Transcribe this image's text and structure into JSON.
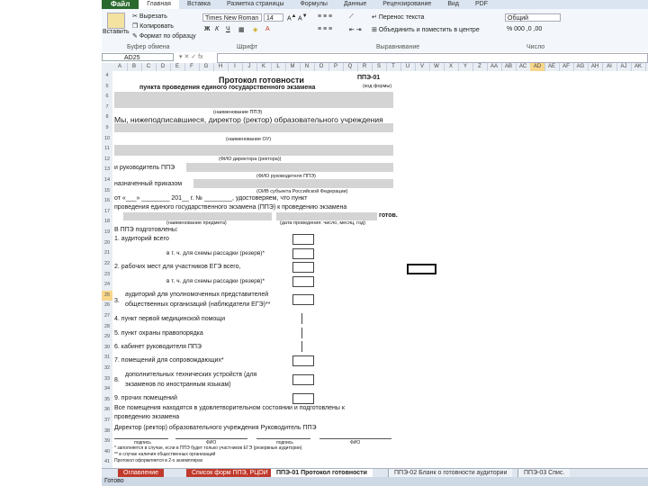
{
  "ribbon_tabs": [
    "Файл",
    "Главная",
    "Вставка",
    "Разметка страницы",
    "Формулы",
    "Данные",
    "Рецензирование",
    "Вид",
    "PDF"
  ],
  "ribbon": {
    "paste_label": "Вставить",
    "cut_label": "Вырезать",
    "copy_label": "Копировать",
    "format_painter_label": "Формат по образцу",
    "clipboard_group": "Буфер обмена",
    "font_name": "Times New Roman",
    "font_size": "14",
    "font_group": "Шрифт",
    "wrap_text_label": "Перенос текста",
    "merge_label": "Объединить и поместить в центре",
    "align_group": "Выравнивание",
    "number_format": "Общий",
    "number_group": "Число"
  },
  "formula_bar": {
    "cell_ref": "AD25"
  },
  "columns": [
    "A",
    "B",
    "C",
    "D",
    "E",
    "F",
    "G",
    "H",
    "I",
    "J",
    "K",
    "L",
    "M",
    "N",
    "O",
    "P",
    "Q",
    "R",
    "S",
    "T",
    "U",
    "V",
    "W",
    "X",
    "Y",
    "Z",
    "AA",
    "AB",
    "AC",
    "AD",
    "AE",
    "AF",
    "AG",
    "AH",
    "AI",
    "AJ",
    "AK"
  ],
  "active_column": "AD",
  "rows": [
    "4",
    "5",
    "6",
    "7",
    "8",
    "9",
    "10",
    "11",
    "12",
    "13",
    "14",
    "15",
    "16",
    "17",
    "18",
    "19",
    "20",
    "21",
    "22",
    "23",
    "24",
    "25",
    "26",
    "27",
    "28",
    "29",
    "30",
    "31",
    "32",
    "33",
    "34",
    "35",
    "36",
    "37",
    "38",
    "39",
    "40",
    "41"
  ],
  "active_row": "25",
  "form": {
    "title": "Протокол готовности",
    "form_code": "ППЭ-01",
    "subtitle": "пункта проведения единого государственного экзамена",
    "form_note": "(код формы)",
    "ppe_name_caption": "(наименование ППЭ)",
    "we_signed": "Мы, нижеподписавшиеся, директор (ректор) образовательного учреждения",
    "ou_caption": "(наименование ОУ)",
    "director_caption": "(ФИО директора (ректора))",
    "head_ppe": "и руководитель ППЭ",
    "head_ppe_caption": "(ФИО руководителя ППЭ)",
    "appointed": "назначенный приказом",
    "order_caption": "(ОИВ субъекта Российской Федерации)",
    "order_line": "от «___» ________ 201__ г. № ________, удостоверяем, что пункт",
    "conduct_line": "проведения единого государственного экзамена (ППЭ) к проведению экзамена",
    "conduct_caption": "(наименование предмета)",
    "date_caption": "(дата проведения: число, месяц, год)",
    "ready_label": "готов.",
    "prepared": "В ППЭ подготовлены:",
    "item1": "1.  аудиторий всего",
    "item1a": "в т. ч. для схемы рассадки (резерв)*",
    "item2": "2.  рабочих мест для участников ЕГЭ всего,",
    "item2a": "в т. ч. для схемы рассадки (резерв)*",
    "item3a": "аудиторий для уполномоченных представителей",
    "item3_num": "3.",
    "item3b": "общественных организаций (наблюдатели ЕГЭ)**",
    "item4": "4.  пункт первой медицинской помощи",
    "item5": "5.  пункт охраны правопорядка",
    "item6": "6.  кабинет руководителя ППЭ",
    "item7": "7.  помещений для сопровождающих*",
    "item8_num": "8.",
    "item8a": "дополнительных технических устройств (для",
    "item8b": "экзаменов по иностранным языкам)",
    "item9": "9.  прочих помещений",
    "premises_a": "Все помещения находятся в удовлетворительном состоянии и подготовлены к",
    "premises_b": "проведению экзамена",
    "signatures": "Директор (ректор) образовательного учреждения   Руководитель ППЭ",
    "sign_caption_1": "подпись",
    "sign_caption_2": "ФИО",
    "sign_caption_3": "подпись",
    "sign_caption_4": "ФИО",
    "footnote_1": "* заполняется в случае, если в ППЭ будет только участников ЕГЭ (резервные аудитории)",
    "footnote_2": "** в случае наличия общественных организаций",
    "footnote_3": "Протокол оформляется в 2-х экземплярах"
  },
  "sheet_tabs": [
    "Оглавление",
    "Список форм ППЭ, РЦОИ",
    "ППЭ-01 Протокол готовности",
    "ППЭ-02 Бланк о готовности аудитории",
    "ППЭ-03 Спис."
  ],
  "active_sheet": "ППЭ-01 Протокол готовности",
  "status_text": "Готово"
}
